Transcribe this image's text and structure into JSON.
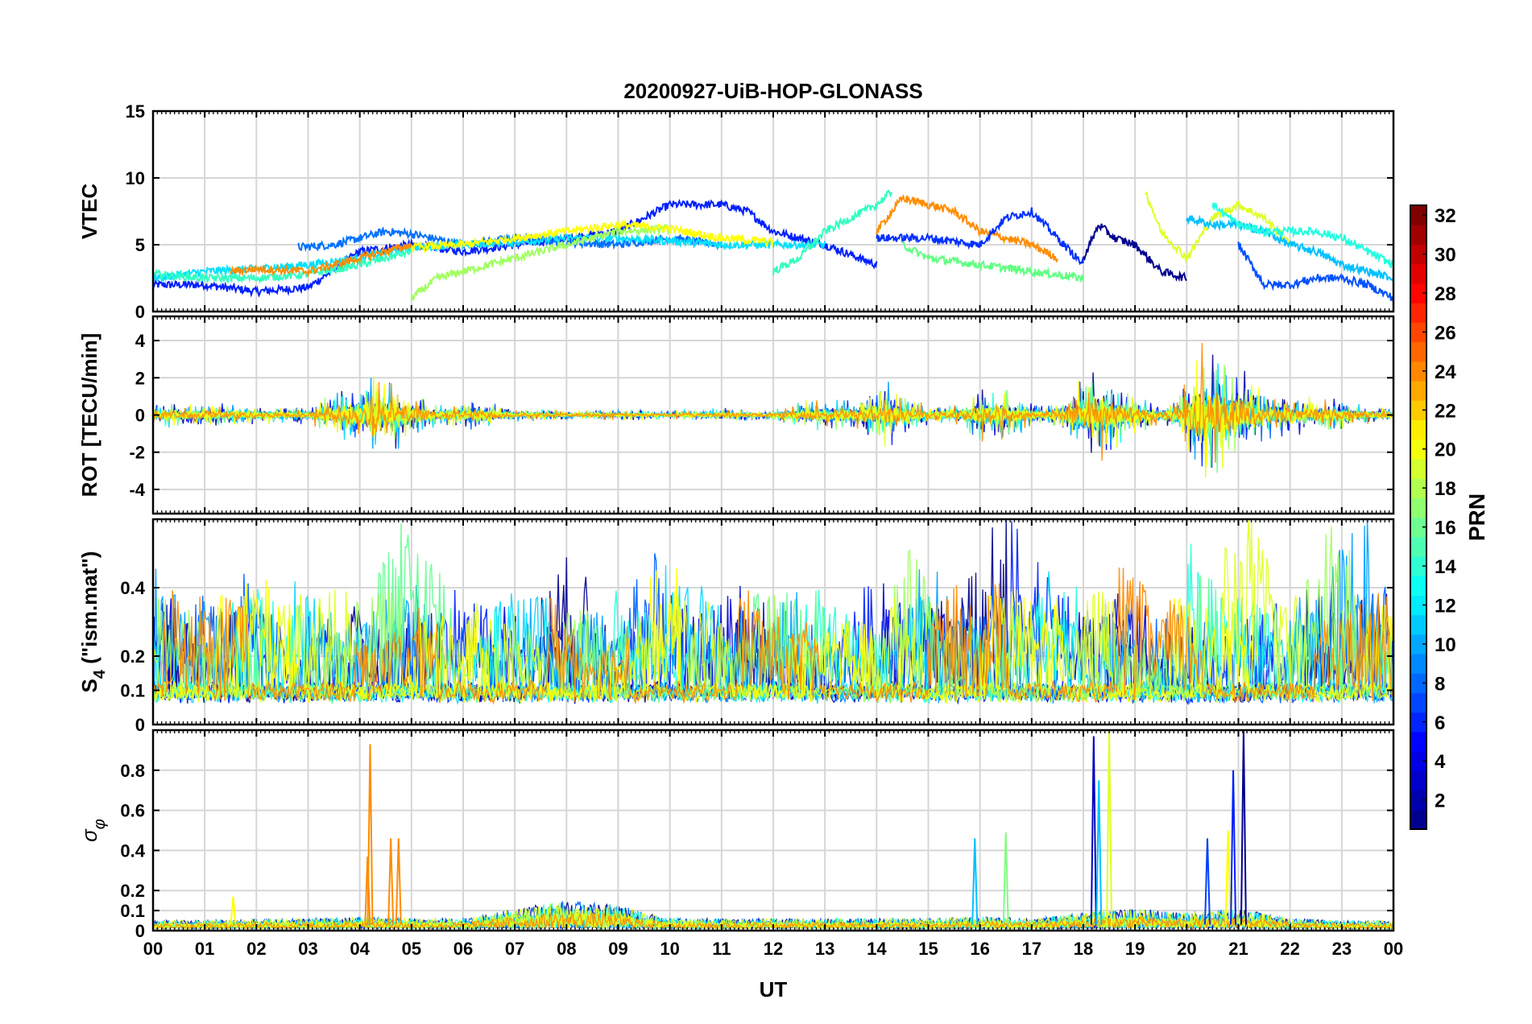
{
  "figure": {
    "title": "20200927-UiB-HOP-GLONASS",
    "xlabel": "UT",
    "x_ticks": [
      "00",
      "01",
      "02",
      "03",
      "04",
      "05",
      "06",
      "07",
      "08",
      "09",
      "10",
      "11",
      "12",
      "13",
      "14",
      "15",
      "16",
      "17",
      "18",
      "19",
      "20",
      "21",
      "22",
      "23",
      "00"
    ]
  },
  "colorbar": {
    "label": "PRN",
    "range": [
      1,
      32
    ],
    "ticks": [
      2,
      4,
      6,
      8,
      10,
      12,
      14,
      16,
      18,
      20,
      22,
      24,
      26,
      28,
      30,
      32
    ],
    "tick_labels": [
      "2",
      "4",
      "6",
      "8",
      "10",
      "12",
      "14",
      "16",
      "18",
      "20",
      "22",
      "24",
      "26",
      "28",
      "30",
      "32"
    ],
    "colormap": "jet",
    "colormap_stops": [
      "#00008f",
      "#0000ff",
      "#0080ff",
      "#00ffff",
      "#80ff80",
      "#ffff00",
      "#ff8000",
      "#ff0000",
      "#800000"
    ]
  },
  "chart_data": [
    {
      "type": "line",
      "panel": "vtec",
      "ylabel": "VTEC",
      "xlim": [
        0,
        24
      ],
      "ylim": [
        0,
        15
      ],
      "y_ticks": [
        0,
        5,
        10,
        15
      ],
      "y_tick_labels": [
        "0",
        "5",
        "10",
        "15"
      ],
      "grid": true,
      "series": [
        {
          "prn": 3,
          "color": "#0020ff",
          "x": [
            0,
            1,
            2,
            3,
            4,
            5,
            6,
            7,
            8,
            9,
            10,
            11,
            11.5,
            12,
            13,
            14
          ],
          "y": [
            2,
            2,
            1.5,
            1.8,
            4.5,
            5,
            4.5,
            5,
            5.5,
            6,
            8,
            8,
            7.5,
            6,
            5,
            3.5
          ]
        },
        {
          "prn": 7,
          "color": "#0070ff",
          "x": [
            2.8,
            3.5,
            4,
            4.5,
            5,
            6,
            7,
            8,
            9,
            10,
            11
          ],
          "y": [
            4.8,
            5,
            5.5,
            6,
            5.8,
            5,
            5.5,
            5.2,
            5,
            5.5,
            5
          ]
        },
        {
          "prn": 12,
          "color": "#00e0ff",
          "x": [
            0,
            1,
            2,
            3,
            4,
            5,
            6,
            7,
            8,
            9,
            10,
            11,
            12,
            13
          ],
          "y": [
            2.5,
            3,
            3.2,
            3.5,
            4,
            4.8,
            5,
            5.2,
            5.5,
            5.5,
            5.3,
            5,
            5,
            5
          ]
        },
        {
          "prn": 14,
          "color": "#30ffc0",
          "x": [
            0,
            1,
            2,
            3,
            4,
            5
          ],
          "y": [
            2.8,
            2.5,
            2.5,
            2.8,
            3.5,
            4.5
          ]
        },
        {
          "prn": 17,
          "color": "#a0ff60",
          "x": [
            5,
            5.5,
            6,
            6.5,
            7,
            8,
            9,
            10
          ],
          "y": [
            1,
            2.5,
            3,
            3.5,
            4,
            5,
            6,
            6.2
          ]
        },
        {
          "prn": 20,
          "color": "#ffff00",
          "x": [
            5,
            6,
            7,
            8,
            9,
            10,
            11,
            12
          ],
          "y": [
            4.8,
            5,
            5.5,
            6,
            6.5,
            6.2,
            5.5,
            5.2
          ]
        },
        {
          "prn": 22,
          "color": "#ff8c00",
          "x": [
            1.5,
            2,
            3,
            3.5,
            4,
            4.5,
            5
          ],
          "y": [
            3,
            3.2,
            3,
            3.5,
            4,
            4.5,
            5
          ]
        },
        {
          "prn": 14,
          "color": "#30ffc0",
          "x": [
            12,
            12.5,
            13,
            13.5,
            14,
            14.3
          ],
          "y": [
            3,
            4,
            6,
            7,
            8,
            9
          ]
        },
        {
          "prn": 22,
          "color": "#ff8c00",
          "x": [
            14,
            14.5,
            15,
            15.5,
            16,
            17,
            17.5
          ],
          "y": [
            6,
            8.5,
            8,
            7.5,
            6,
            5,
            4
          ]
        },
        {
          "prn": 4,
          "color": "#0030ff",
          "x": [
            14,
            15,
            16,
            16.5,
            17,
            18
          ],
          "y": [
            5.5,
            5.5,
            5,
            7,
            7.5,
            3.5
          ]
        },
        {
          "prn": 16,
          "color": "#60ff80",
          "x": [
            14.5,
            15,
            16,
            17,
            18
          ],
          "y": [
            5,
            4,
            3.5,
            3,
            2.5
          ]
        },
        {
          "prn": 1,
          "color": "#00008f",
          "x": [
            18,
            18.3,
            18.6,
            19,
            19.5,
            20
          ],
          "y": [
            4,
            6.5,
            5.5,
            5,
            3,
            2.5
          ]
        },
        {
          "prn": 19,
          "color": "#e0ff20",
          "x": [
            19.2,
            19.5,
            20,
            20.5,
            21,
            21.5,
            22
          ],
          "y": [
            9,
            6,
            4,
            7,
            8,
            7,
            5
          ]
        },
        {
          "prn": 11,
          "color": "#00c0ff",
          "x": [
            20,
            20.5,
            21,
            21.5,
            22,
            22.5,
            23,
            23.5,
            24
          ],
          "y": [
            7,
            6.5,
            6.5,
            6,
            5,
            4.5,
            3.5,
            3,
            2.5
          ]
        },
        {
          "prn": 13,
          "color": "#20ffe0",
          "x": [
            20.5,
            21,
            21.5,
            22,
            22.5,
            23,
            23.5,
            24
          ],
          "y": [
            8,
            6.5,
            6,
            6,
            6,
            5.5,
            4.5,
            3.5
          ]
        },
        {
          "prn": 6,
          "color": "#0050ff",
          "x": [
            21,
            21.5,
            22,
            22.5,
            23,
            23.5,
            24
          ],
          "y": [
            5,
            2,
            2,
            2.5,
            2.5,
            2,
            1
          ]
        }
      ]
    },
    {
      "type": "line",
      "panel": "rot",
      "ylabel": "ROT [TECU/min]",
      "xlim": [
        0,
        24
      ],
      "ylim": [
        -5.3,
        5.3
      ],
      "y_ticks": [
        -4,
        -2,
        0,
        2,
        4
      ],
      "y_tick_labels": [
        "-4",
        "-2",
        "0",
        "2",
        "4"
      ],
      "grid": true,
      "activity": [
        {
          "x": [
            0,
            1,
            2,
            3,
            3.8,
            4.2,
            4.6,
            5,
            5.5,
            6,
            6.5,
            7,
            8,
            9,
            10,
            11,
            12,
            12.5,
            13,
            13.5,
            14,
            14.3,
            14.6,
            15,
            15.5,
            16,
            16.5,
            17,
            17.5,
            18,
            18.3,
            18.6,
            19,
            19.5,
            20,
            20.3,
            20.6,
            21,
            21.5,
            22,
            22.5,
            23,
            23.5,
            24
          ],
          "amplitude": [
            0.8,
            0.7,
            0.6,
            0.5,
            1.8,
            2.5,
            2.2,
            1.5,
            0.6,
            0.9,
            0.8,
            0.4,
            0.3,
            0.3,
            0.3,
            0.4,
            0.3,
            0.8,
            1.0,
            1.0,
            1.6,
            2.0,
            1.2,
            0.6,
            0.6,
            1.5,
            1.8,
            0.7,
            0.6,
            2.5,
            3.0,
            2.2,
            1.4,
            0.6,
            2.0,
            4.5,
            3.5,
            3.0,
            1.5,
            1.2,
            1.0,
            1.0,
            0.6,
            0.4
          ]
        }
      ]
    },
    {
      "type": "line",
      "panel": "s4",
      "ylabel": "S4 (\"ism.mat\")",
      "ylabel_main": "S",
      "ylabel_sub": "4",
      "ylabel_rest": " (\"ism.mat\")",
      "xlim": [
        0,
        24
      ],
      "ylim": [
        0,
        0.6
      ],
      "y_ticks": [
        0,
        0.1,
        0.2,
        0.4
      ],
      "y_tick_labels": [
        "0",
        "0.1",
        "0.2",
        "0.4"
      ],
      "grid": true,
      "activity": [
        {
          "x": [
            0,
            1,
            2,
            3,
            4,
            4.5,
            5,
            5.5,
            6,
            6.5,
            7,
            7.5,
            8,
            8.5,
            9,
            9.5,
            10,
            10.5,
            11,
            11.5,
            12,
            12.5,
            13,
            13.5,
            14,
            14.5,
            15,
            15.5,
            16,
            16.5,
            17,
            17.5,
            18,
            18.5,
            19,
            19.5,
            20,
            20.5,
            21,
            21.5,
            22,
            22.5,
            23,
            23.5,
            24
          ],
          "level": [
            0.25,
            0.2,
            0.3,
            0.35,
            0.3,
            0.4,
            0.25,
            0.15,
            0.3,
            0.25,
            0.15,
            0.25,
            0.3,
            0.25,
            0.2,
            0.25,
            0.35,
            0.3,
            0.2,
            0.15,
            0.35,
            0.45,
            0.3,
            0.2,
            0.35,
            0.3,
            0.2,
            0.25,
            0.25,
            0.2,
            0.15,
            0.2,
            0.35,
            0.3,
            0.35,
            0.3,
            0.3,
            0.5,
            0.55,
            0.4,
            0.3,
            0.3,
            0.25,
            0.2,
            0.15
          ]
        }
      ]
    },
    {
      "type": "line",
      "panel": "sigma_phi",
      "ylabel": "σφ",
      "ylabel_main": "σ",
      "ylabel_sub": "φ",
      "xlim": [
        0,
        24
      ],
      "ylim": [
        0,
        1
      ],
      "y_ticks": [
        0,
        0.1,
        0.2,
        0.4,
        0.6,
        0.8
      ],
      "y_tick_labels": [
        "0",
        "0.1",
        "0.2",
        "0.4",
        "0.6",
        "0.8"
      ],
      "grid": true,
      "spikes": [
        {
          "x": 4.2,
          "y": 0.93,
          "color": "#ff8c00"
        },
        {
          "x": 4.15,
          "y": 0.37,
          "color": "#ff8c00"
        },
        {
          "x": 4.6,
          "y": 0.46,
          "color": "#ff8c00"
        },
        {
          "x": 4.75,
          "y": 0.46,
          "color": "#ff8c00"
        },
        {
          "x": 1.55,
          "y": 0.17,
          "color": "#ffff00"
        },
        {
          "x": 15.9,
          "y": 0.46,
          "color": "#00c0ff"
        },
        {
          "x": 16.5,
          "y": 0.49,
          "color": "#80ff80"
        },
        {
          "x": 18.2,
          "y": 0.97,
          "color": "#0000c0"
        },
        {
          "x": 18.3,
          "y": 0.75,
          "color": "#00c0ff"
        },
        {
          "x": 18.5,
          "y": 1.0,
          "color": "#e0ff20"
        },
        {
          "x": 20.4,
          "y": 0.46,
          "color": "#0040ff"
        },
        {
          "x": 20.8,
          "y": 0.5,
          "color": "#ffff00"
        },
        {
          "x": 20.9,
          "y": 0.8,
          "color": "#0020ff"
        },
        {
          "x": 21.1,
          "y": 1.0,
          "color": "#00008f"
        }
      ],
      "activity": [
        {
          "x": [
            0,
            3,
            4,
            5,
            6,
            7,
            7.5,
            8,
            9,
            9.5,
            10,
            12,
            15,
            16,
            17,
            18,
            19,
            20,
            21,
            22,
            23,
            24
          ],
          "level": [
            0.04,
            0.05,
            0.06,
            0.05,
            0.05,
            0.1,
            0.12,
            0.14,
            0.12,
            0.08,
            0.05,
            0.05,
            0.05,
            0.06,
            0.05,
            0.08,
            0.1,
            0.08,
            0.1,
            0.05,
            0.04,
            0.04
          ]
        }
      ]
    }
  ]
}
